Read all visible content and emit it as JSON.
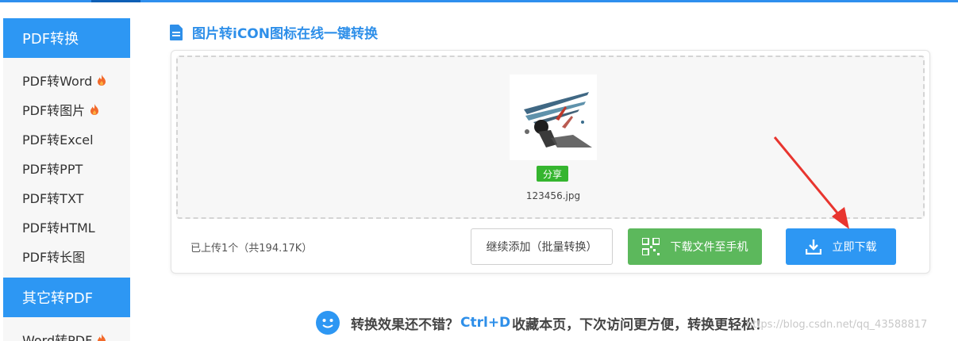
{
  "sidebar": {
    "section1_title": "PDF转换",
    "items": [
      {
        "label": "PDF转Word",
        "hot": true
      },
      {
        "label": "PDF转图片",
        "hot": true
      },
      {
        "label": "PDF转Excel",
        "hot": false
      },
      {
        "label": "PDF转PPT",
        "hot": false
      },
      {
        "label": "PDF转TXT",
        "hot": false
      },
      {
        "label": "PDF转HTML",
        "hot": false
      },
      {
        "label": "PDF转长图",
        "hot": false
      }
    ],
    "section2_title": "其它转PDF",
    "items2": [
      {
        "label": "Word转PDF",
        "hot": true
      }
    ]
  },
  "main": {
    "title": "图片转iCON图标在线一键转换",
    "file": {
      "name": "123456.jpg",
      "share_label": "分享"
    },
    "upload_info": "已上传1个（共194.17K）",
    "buttons": {
      "continue": "继续添加（批量转换）",
      "to_phone": "下载文件至手机",
      "download": "立即下载"
    }
  },
  "footer": {
    "text_before": "转换效果还不错？",
    "shortcut": "Ctrl+D",
    "text_after": "收藏本页，下次访问更方便，转换更轻松！"
  },
  "watermark": "https://blog.csdn.net/qq_43588817",
  "colors": {
    "accent": "#2d97f3",
    "green": "#5cb85c",
    "share_green": "#35b52f",
    "hot": "#f26a2b",
    "arrow": "#e8352f"
  }
}
